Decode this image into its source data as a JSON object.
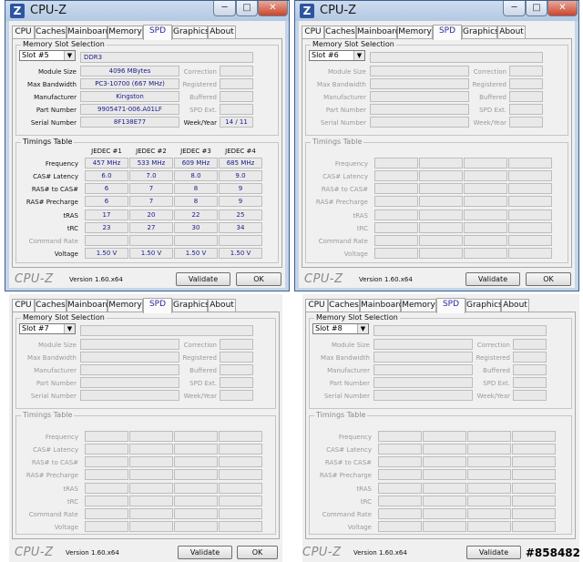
{
  "app_title": "CPU-Z",
  "tabs": [
    "CPU",
    "Caches",
    "Mainboard",
    "Memory",
    "SPD",
    "Graphics",
    "About"
  ],
  "active_tab": "SPD",
  "labels": {
    "memory_slot_selection": "Memory Slot Selection",
    "timings_table": "Timings Table",
    "module_size": "Module Size",
    "max_bandwidth": "Max Bandwidth",
    "manufacturer": "Manufacturer",
    "part_number": "Part Number",
    "serial_number": "Serial Number",
    "correction": "Correction",
    "registered": "Registered",
    "buffered": "Buffered",
    "spd_ext": "SPD Ext.",
    "week_year": "Week/Year",
    "jedec1": "JEDEC #1",
    "jedec2": "JEDEC #2",
    "jedec3": "JEDEC #3",
    "jedec4": "JEDEC #4",
    "frequency": "Frequency",
    "cas_latency": "CAS# Latency",
    "ras_to_cas": "RAS# to CAS#",
    "ras_precharge": "RAS# Precharge",
    "tras": "tRAS",
    "trc": "tRC",
    "command_rate": "Command Rate",
    "voltage": "Voltage"
  },
  "footer": {
    "brand": "CPU-Z",
    "version": "Version 1.60.x64",
    "validate": "Validate",
    "ok": "OK"
  },
  "window_buttons": {
    "minimize": "─",
    "maximize": "□",
    "close": "✕"
  },
  "slot5": {
    "slot": "Slot #5",
    "memory_type": "DDR3",
    "module_size": "4096 MBytes",
    "max_bandwidth": "PC3-10700 (667 MHz)",
    "manufacturer": "Kingston",
    "part_number": "9905471-006.A01LF",
    "serial_number": "8F138E77",
    "week_year": "14 / 11",
    "timings": {
      "frequency": [
        "457 MHz",
        "533 MHz",
        "609 MHz",
        "685 MHz"
      ],
      "cas_latency": [
        "6.0",
        "7.0",
        "8.0",
        "9.0"
      ],
      "ras_to_cas": [
        "6",
        "7",
        "8",
        "9"
      ],
      "ras_precharge": [
        "6",
        "7",
        "8",
        "9"
      ],
      "tras": [
        "17",
        "20",
        "22",
        "25"
      ],
      "trc": [
        "23",
        "27",
        "30",
        "34"
      ],
      "voltage": [
        "1.50 V",
        "1.50 V",
        "1.50 V",
        "1.50 V"
      ]
    }
  },
  "slot6": {
    "slot": "Slot #6"
  },
  "slot7": {
    "slot": "Slot #7"
  },
  "slot8": {
    "slot": "Slot #8"
  },
  "watermark": "#858482"
}
